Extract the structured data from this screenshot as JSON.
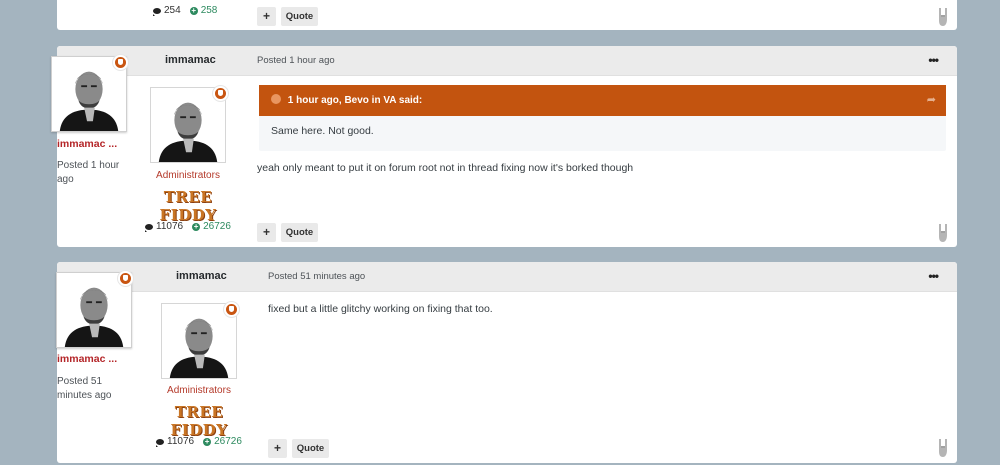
{
  "top_post": {
    "comments": "254",
    "reputation": "258",
    "quote_label": "Quote",
    "plus_label": "+"
  },
  "post1": {
    "author": "immamac",
    "posted": "Posted 1 hour ago",
    "float_name": "immamac ...",
    "float_posted": "Posted 1 hour ago",
    "group": "Administrators",
    "rank": "TREE FIDDY",
    "comments": "11076",
    "reputation": "26726",
    "quote": {
      "header": "1 hour ago, Bevo in VA said:",
      "text": "Same here.  Not good."
    },
    "content": "yeah only meant to put it on forum root not in thread fixing now it's borked though",
    "quote_label": "Quote",
    "plus_label": "+"
  },
  "post2": {
    "author": "immamac",
    "posted": "Posted 51 minutes ago",
    "float_name": "immamac ...",
    "float_posted": "Posted 51 minutes ago",
    "group": "Administrators",
    "rank": "TREE FIDDY",
    "comments": "11076",
    "reputation": "26726",
    "content": "fixed but a little glitchy working on fixing that too.",
    "quote_label": "Quote",
    "plus_label": "+"
  },
  "icons": {
    "more": "more-options-icon",
    "comment": "comment-icon",
    "reputation": "reputation-icon",
    "reaction": "rock-on-hand-icon",
    "badge": "shield-badge-icon"
  },
  "colors": {
    "accent": "#c3540f",
    "name": "#b42528",
    "reputation": "#2d8a5f",
    "background": "#a4b4bf"
  }
}
